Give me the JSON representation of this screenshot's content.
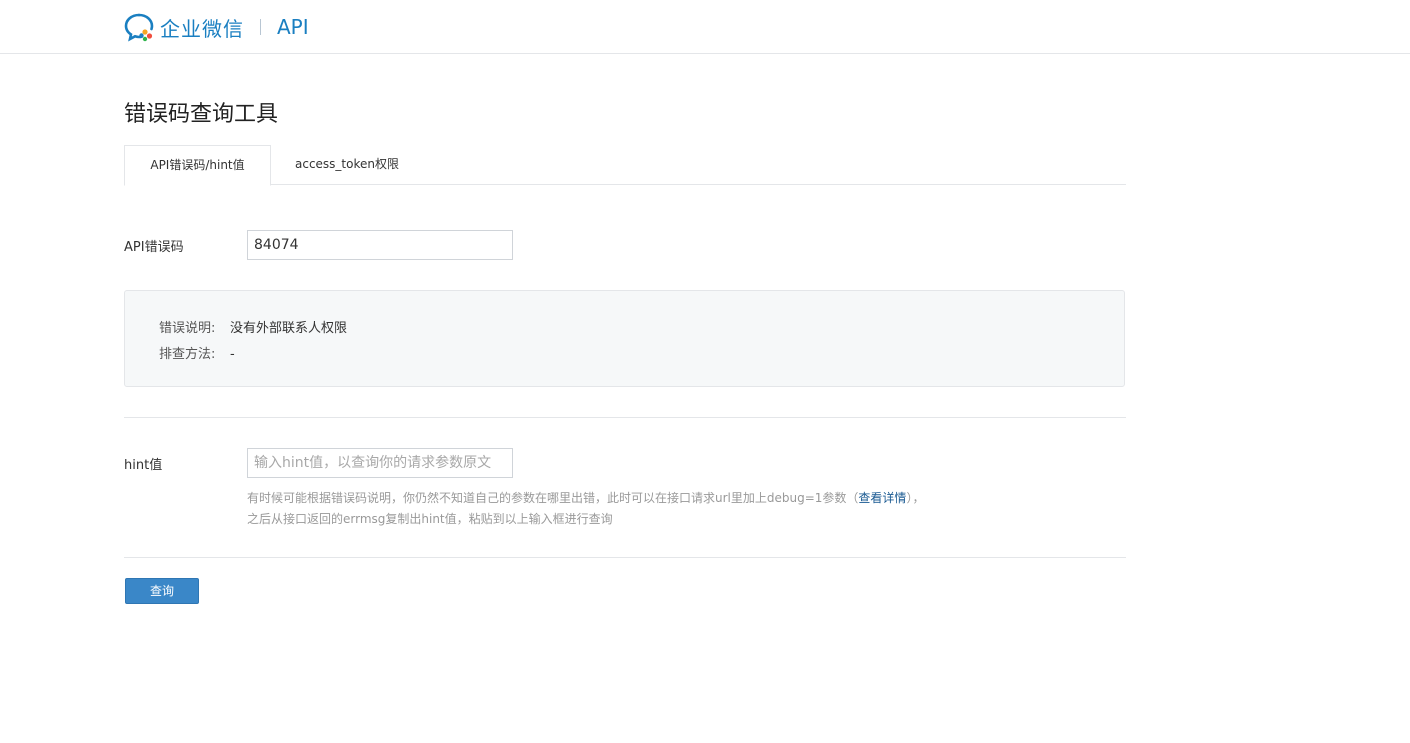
{
  "header": {
    "brand_name": "企业微信",
    "brand_sub": "API"
  },
  "page": {
    "title": "错误码查询工具"
  },
  "tabs": [
    {
      "label": "API错误码/hint值",
      "active": true
    },
    {
      "label": "access_token权限",
      "active": false
    }
  ],
  "error_code": {
    "label": "API错误码",
    "value": "84074"
  },
  "result": {
    "desc_key": "错误说明:",
    "desc_value": "没有外部联系人权限",
    "method_key": "排查方法:",
    "method_value": "-"
  },
  "hint": {
    "label": "hint值",
    "placeholder": "输入hint值，以查询你的请求参数原文",
    "desc_part1": "有时候可能根据错误码说明，你仍然不知道自己的参数在哪里出错，此时可以在接口请求url里加上debug=1参数（",
    "desc_link": "查看详情",
    "desc_part2": "），",
    "desc_line2": "之后从接口返回的errmsg复制出hint值，粘贴到以上输入框进行查询"
  },
  "actions": {
    "query_label": "查询"
  },
  "colors": {
    "brand": "#1a7fc1",
    "button": "#3a87c8",
    "link": "#1a5a92"
  },
  "icons": {
    "logo": "wecom-chat-bubble-icon"
  }
}
